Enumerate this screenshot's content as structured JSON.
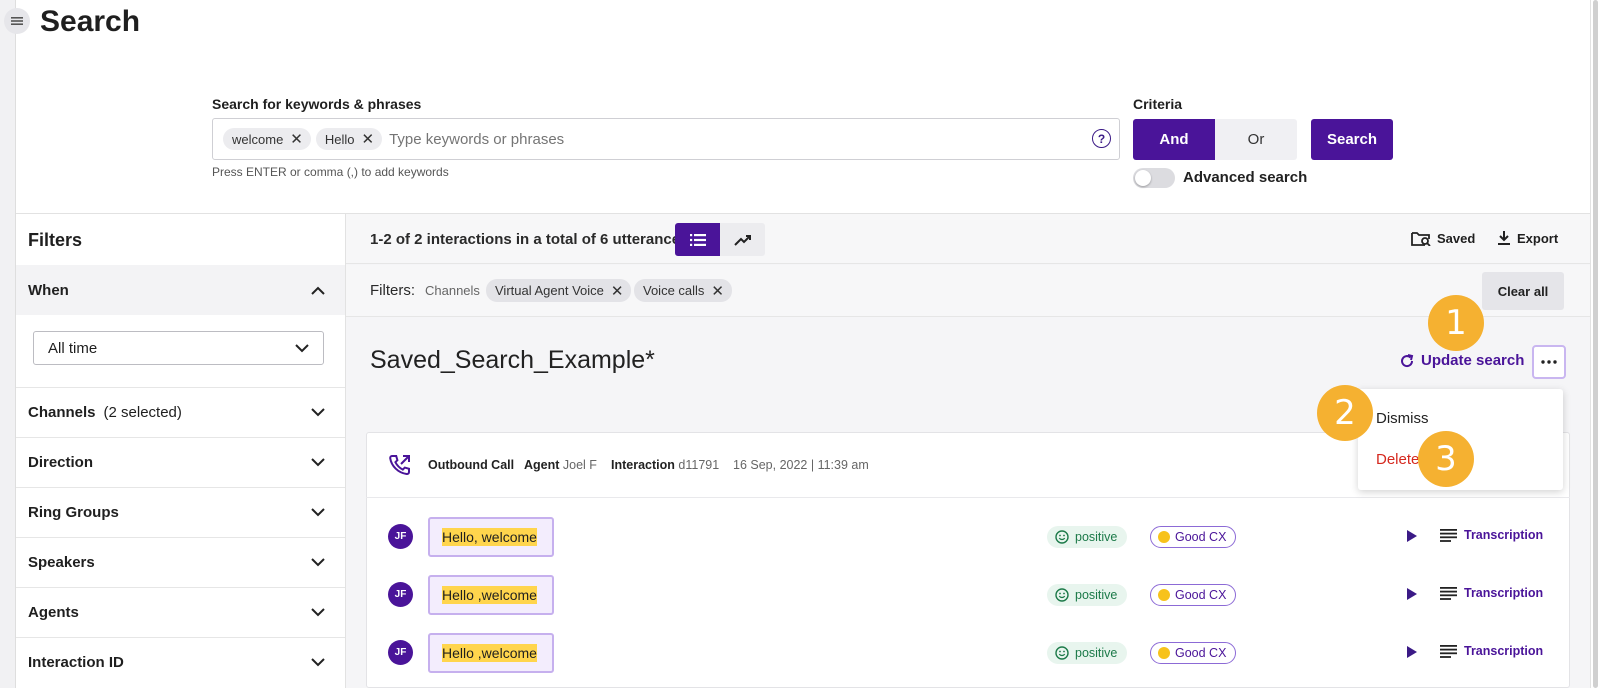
{
  "page": {
    "title": "Search"
  },
  "search": {
    "label": "Search for keywords & phrases",
    "keywords": [
      "welcome",
      "Hello"
    ],
    "placeholder": "Type keywords or phrases",
    "hint": "Press ENTER or comma (,) to add keywords"
  },
  "criteria": {
    "label": "Criteria",
    "and_label": "And",
    "or_label": "Or",
    "selected": "And",
    "search_button": "Search",
    "advanced_label": "Advanced search",
    "advanced_enabled": false
  },
  "filters_panel": {
    "title": "Filters",
    "when": {
      "label": "When",
      "value": "All time"
    },
    "items": [
      {
        "label": "Channels",
        "sub": "(2 selected)"
      },
      {
        "label": "Direction",
        "sub": ""
      },
      {
        "label": "Ring Groups",
        "sub": ""
      },
      {
        "label": "Speakers",
        "sub": ""
      },
      {
        "label": "Agents",
        "sub": ""
      },
      {
        "label": "Interaction ID",
        "sub": ""
      }
    ]
  },
  "results": {
    "count_text": "1-2 of 2 interactions in a total of 6 utterances",
    "saved_label": "Saved",
    "export_label": "Export"
  },
  "active_filters": {
    "label": "Filters:",
    "group": "Channels",
    "chips": [
      "Virtual Agent Voice",
      "Voice calls"
    ],
    "clear_label": "Clear all"
  },
  "saved_search": {
    "name": "Saved_Search_Example*",
    "update_label": "Update search"
  },
  "menu": {
    "dismiss_label": "Dismiss",
    "delete_label": "Delete"
  },
  "interaction": {
    "type": "Outbound Call",
    "agent_label": "Agent",
    "agent_name": "Joel F",
    "interaction_label": "Interaction",
    "interaction_id": "d11791",
    "datetime": "16 Sep, 2022 | 11:39 am"
  },
  "utterances": [
    {
      "initials": "JF",
      "text": "Hello, welcome",
      "sentiment": "positive",
      "cx": "Good CX",
      "transcription_label": "Transcription"
    },
    {
      "initials": "JF",
      "text": "Hello ,welcome",
      "sentiment": "positive",
      "cx": "Good CX",
      "transcription_label": "Transcription"
    },
    {
      "initials": "JF",
      "text": "Hello ,welcome",
      "sentiment": "positive",
      "cx": "Good CX",
      "transcription_label": "Transcription"
    }
  ],
  "callouts": [
    "1",
    "2",
    "3"
  ],
  "colors": {
    "brand": "#4a1499",
    "callout": "#f5b131",
    "delete": "#d5281e",
    "cx_dot": "#f7c21b"
  }
}
